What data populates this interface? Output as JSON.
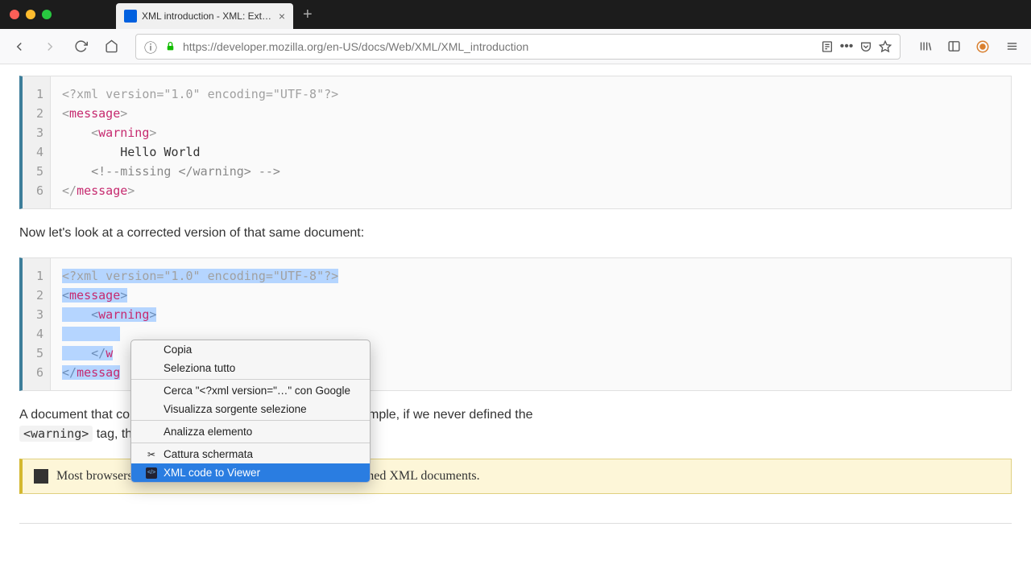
{
  "tab": {
    "title": "XML introduction - XML: Extens"
  },
  "url": {
    "base": "https://developer.mozilla.org",
    "path": "/en-US/docs/Web/XML/XML_introduction"
  },
  "code1": {
    "lines": [
      1,
      2,
      3,
      4,
      5,
      6
    ],
    "l1_pi": "<?xml version=\"1.0\" encoding=\"UTF-8\"?>",
    "l2_tag": "message",
    "l3_indent": "    ",
    "l3_tag": "warning",
    "l4": "        Hello World",
    "l5_indent": "    ",
    "l5_comment": "<!--missing </warning> -->",
    "l6_tag": "message"
  },
  "para1": "Now let's look at a corrected version of that same document:",
  "code2": {
    "lines": [
      1,
      2,
      3,
      4,
      5,
      6
    ],
    "l1_pi": "<?xml version=\"1.0\" encoding=\"UTF-8\"?>",
    "l2_tag": "message",
    "l3_indent": "    ",
    "l3_tag": "warning",
    "l4_indent": "        ",
    "l5_indent": "    ",
    "l5_frag": "w",
    "l6_frag": "messag"
  },
  "para2_a": "A document that co",
  "para2_b": "mple, if we never defined the ",
  "inline_tag": "<warning>",
  "para2_c": " tag, th",
  "note": "Most browsers offer a debugger that can identify poorly-formed XML documents.",
  "ctx": {
    "copy": "Copia",
    "select_all": "Seleziona tutto",
    "search": "Cerca \"<?xml version=\"…\" con Google",
    "view_source": "Visualizza sorgente selezione",
    "inspect": "Analizza elemento",
    "screenshot": "Cattura schermata",
    "xml_viewer": "XML code to Viewer"
  }
}
